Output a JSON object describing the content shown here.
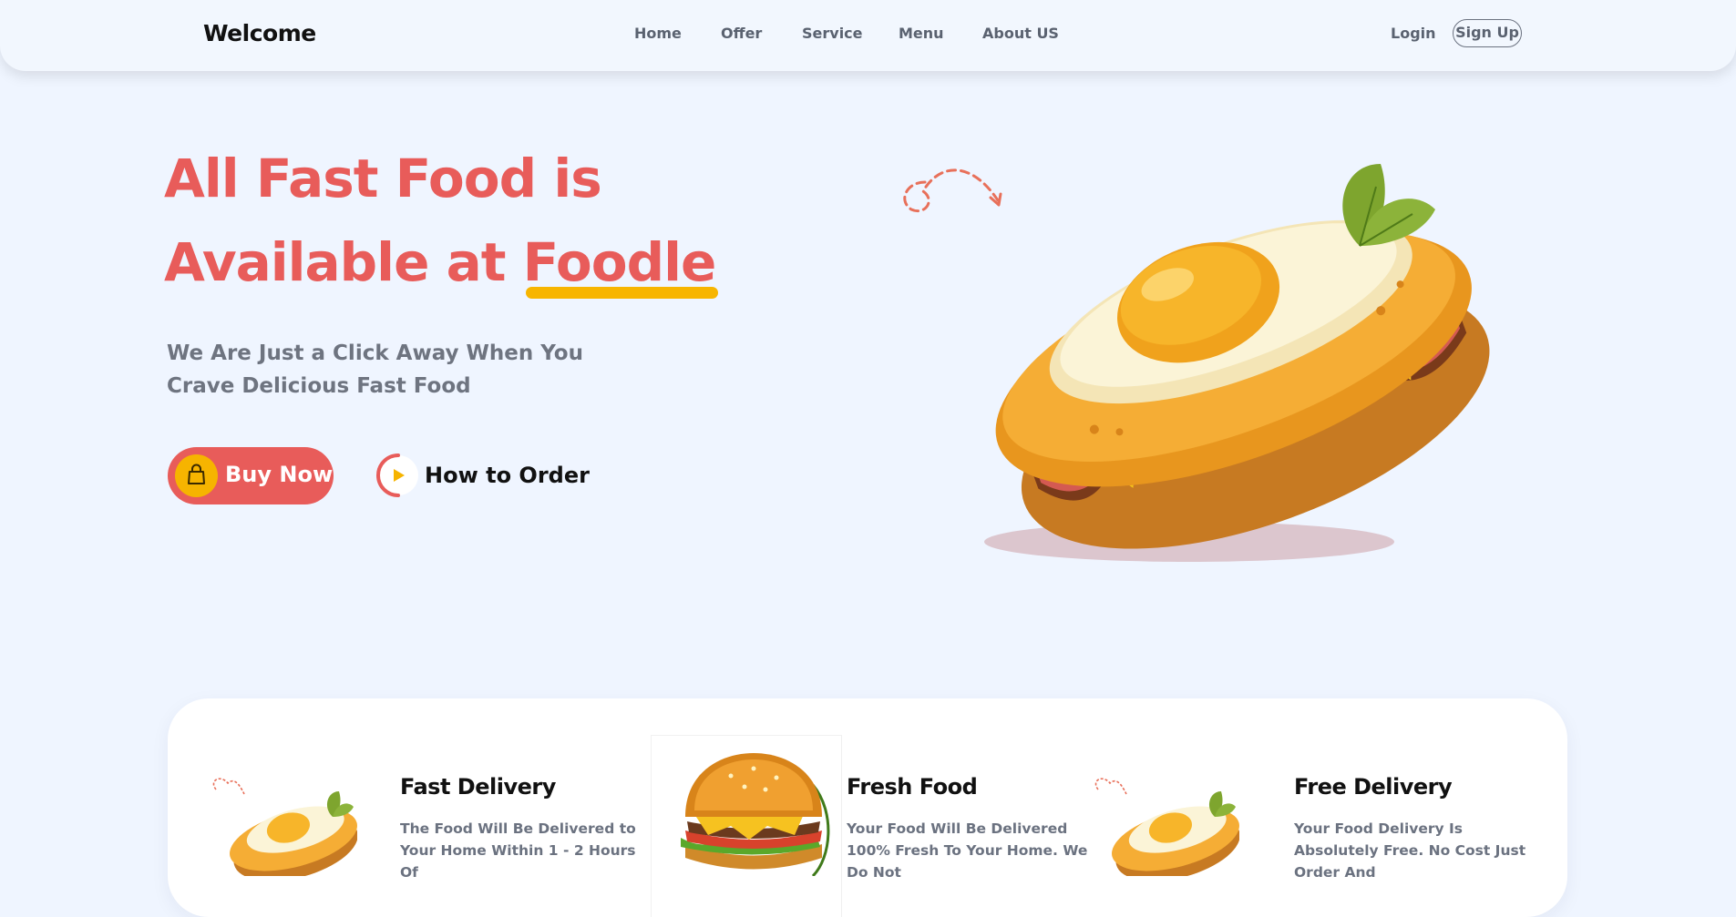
{
  "nav": {
    "brand": "Welcome",
    "links": [
      "Home",
      "Offer",
      "Service",
      "Menu",
      "About US"
    ],
    "login": "Login",
    "signup": "Sign Up"
  },
  "hero": {
    "title_line1": "All Fast Food is",
    "title_line2_prefix": "Available at ",
    "title_highlight": "Foodle",
    "subtitle_line1": "We Are Just a Click Away When You",
    "subtitle_line2": "Crave Delicious Fast Food",
    "buy_button": "Buy Now",
    "how_button": "How to Order"
  },
  "features": [
    {
      "title": "Fast Delivery",
      "text": "The Food Will Be Delivered to Your Home Within 1 - 2 Hours Of"
    },
    {
      "title": "Fresh Food",
      "text": "Your Food Will Be Delivered 100% Fresh To Your Home. We Do Not"
    },
    {
      "title": "Free Delivery",
      "text": "Your Food Delivery Is Absolutely Free. No Cost Just Order And"
    }
  ],
  "icons": {
    "buy": "shopping-bag-icon",
    "how": "play-icon"
  },
  "colors": {
    "accent_red": "#e85c5a",
    "accent_yellow": "#f6b400",
    "background": "#eff5ff"
  }
}
